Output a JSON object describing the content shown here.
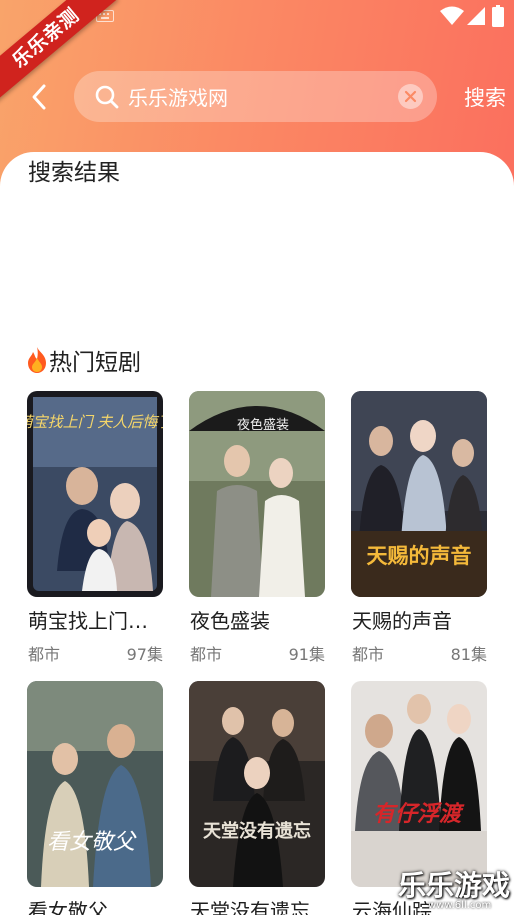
{
  "watermark": {
    "badge": "乐乐亲测",
    "site_name": "乐乐游戏",
    "site_url": "www.6ll.com"
  },
  "status_bar": {
    "keyboard_icon": "keyboard-icon",
    "wifi_icon": "wifi-icon",
    "signal_icon": "signal-icon",
    "battery_icon": "battery-icon"
  },
  "header": {
    "back_icon": "back-arrow-icon",
    "search_icon": "search-icon",
    "search_value": "乐乐游戏网",
    "clear_icon": "clear-icon",
    "search_button": "搜索"
  },
  "results": {
    "title": "搜索结果"
  },
  "hot": {
    "icon": "fire-icon",
    "title": "热门短剧",
    "items": [
      {
        "title": "萌宝找上门…",
        "genre": "都市",
        "episodes": "97集",
        "poster_text": "萌宝找上门 夫人后悔了",
        "accent": "#f5d66a"
      },
      {
        "title": "夜色盛装",
        "genre": "都市",
        "episodes": "91集",
        "poster_text": "夜色盛装",
        "accent": "#2b2b2b"
      },
      {
        "title": "天赐的声音",
        "genre": "都市",
        "episodes": "81集",
        "poster_text": "天赐的声音",
        "accent": "#f4b93a"
      },
      {
        "title": "看女敬父",
        "genre": "",
        "episodes": "",
        "poster_text": "看女敬父",
        "accent": "#ffffff"
      },
      {
        "title": "天堂没有遗忘",
        "genre": "",
        "episodes": "",
        "poster_text": "天堂没有遗忘",
        "accent": "#e8e2d6"
      },
      {
        "title": "云海仙踪",
        "genre": "",
        "episodes": "",
        "poster_text": "有仔浮渡",
        "accent": "#d6262a"
      }
    ]
  }
}
